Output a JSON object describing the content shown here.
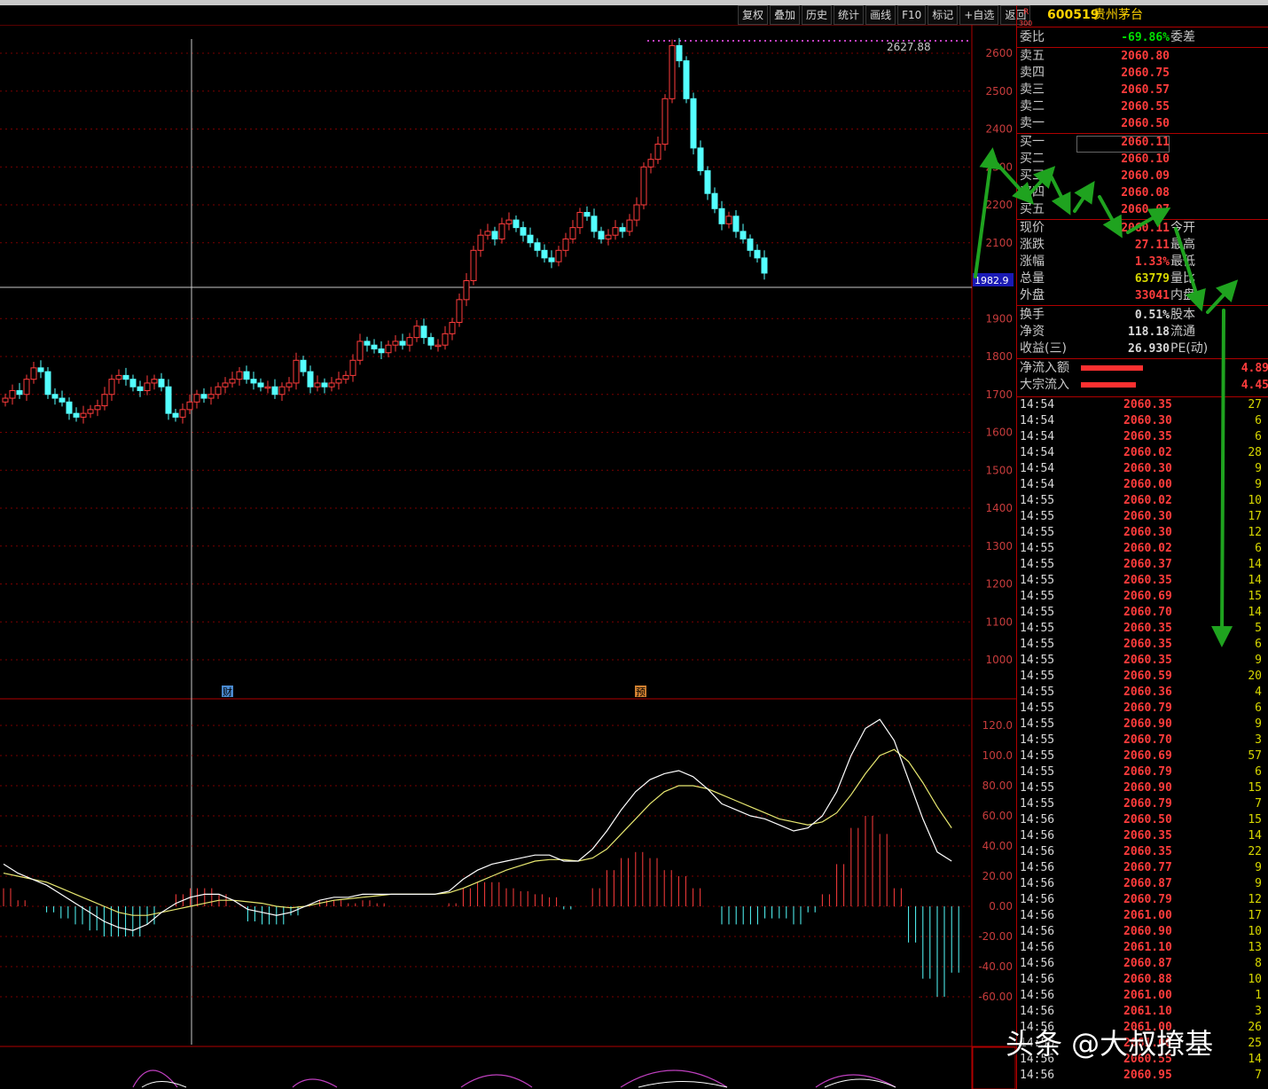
{
  "toolbar": {
    "buttons": [
      "复权",
      "叠加",
      "历史",
      "统计",
      "画线",
      "F10",
      "标记",
      "+自选",
      "返回"
    ]
  },
  "stock": {
    "r_label": "R",
    "index_label": "300",
    "code": "600519",
    "name": "贵州茅台"
  },
  "weibi": {
    "label": "委比",
    "value": "-69.86%",
    "label2": "委差"
  },
  "sell_levels": [
    {
      "label": "卖五",
      "price": "2060.80"
    },
    {
      "label": "卖四",
      "price": "2060.75"
    },
    {
      "label": "卖三",
      "price": "2060.57"
    },
    {
      "label": "卖二",
      "price": "2060.55"
    },
    {
      "label": "卖一",
      "price": "2060.50"
    }
  ],
  "buy_levels": [
    {
      "label": "买一",
      "price": "2060.11"
    },
    {
      "label": "买二",
      "price": "2060.10"
    },
    {
      "label": "买三",
      "price": "2060.09"
    },
    {
      "label": "买四",
      "price": "2060.08"
    },
    {
      "label": "买五",
      "price": "2060.07"
    }
  ],
  "quote_rows": [
    {
      "label": "现价",
      "value": "2060.11",
      "label2": "今开"
    },
    {
      "label": "涨跌",
      "value": "27.11",
      "label2": "最高"
    },
    {
      "label": "涨幅",
      "value": "1.33%",
      "label2": "最低"
    },
    {
      "label": "总量",
      "value": "63779",
      "label2": "量比"
    },
    {
      "label": "外盘",
      "value": "33041",
      "label2": "内盘"
    },
    {
      "label": "换手",
      "value": "0.51%",
      "label2": "股本"
    },
    {
      "label": "净资",
      "value": "118.18",
      "label2": "流通"
    },
    {
      "label": "收益(三)",
      "value": "26.930",
      "label2": "PE(动)"
    }
  ],
  "flows": [
    {
      "label": "净流入额",
      "value": "4.89"
    },
    {
      "label": "大宗流入",
      "value": "4.45"
    }
  ],
  "trades": [
    {
      "time": "14:54",
      "price": "2060.35",
      "vol": "27"
    },
    {
      "time": "14:54",
      "price": "2060.30",
      "vol": "6"
    },
    {
      "time": "14:54",
      "price": "2060.35",
      "vol": "6"
    },
    {
      "time": "14:54",
      "price": "2060.02",
      "vol": "28"
    },
    {
      "time": "14:54",
      "price": "2060.30",
      "vol": "9"
    },
    {
      "time": "14:54",
      "price": "2060.00",
      "vol": "9"
    },
    {
      "time": "14:55",
      "price": "2060.02",
      "vol": "10"
    },
    {
      "time": "14:55",
      "price": "2060.30",
      "vol": "17"
    },
    {
      "time": "14:55",
      "price": "2060.30",
      "vol": "12"
    },
    {
      "time": "14:55",
      "price": "2060.02",
      "vol": "6"
    },
    {
      "time": "14:55",
      "price": "2060.37",
      "vol": "14"
    },
    {
      "time": "14:55",
      "price": "2060.35",
      "vol": "14"
    },
    {
      "time": "14:55",
      "price": "2060.69",
      "vol": "15"
    },
    {
      "time": "14:55",
      "price": "2060.70",
      "vol": "14"
    },
    {
      "time": "14:55",
      "price": "2060.35",
      "vol": "5"
    },
    {
      "time": "14:55",
      "price": "2060.35",
      "vol": "6"
    },
    {
      "time": "14:55",
      "price": "2060.35",
      "vol": "9"
    },
    {
      "time": "14:55",
      "price": "2060.59",
      "vol": "20"
    },
    {
      "time": "14:55",
      "price": "2060.36",
      "vol": "4"
    },
    {
      "time": "14:55",
      "price": "2060.79",
      "vol": "6"
    },
    {
      "time": "14:55",
      "price": "2060.90",
      "vol": "9"
    },
    {
      "time": "14:55",
      "price": "2060.70",
      "vol": "3"
    },
    {
      "time": "14:55",
      "price": "2060.69",
      "vol": "57"
    },
    {
      "time": "14:55",
      "price": "2060.79",
      "vol": "6"
    },
    {
      "time": "14:55",
      "price": "2060.90",
      "vol": "15"
    },
    {
      "time": "14:55",
      "price": "2060.79",
      "vol": "7"
    },
    {
      "time": "14:56",
      "price": "2060.50",
      "vol": "15"
    },
    {
      "time": "14:56",
      "price": "2060.35",
      "vol": "14"
    },
    {
      "time": "14:56",
      "price": "2060.35",
      "vol": "22"
    },
    {
      "time": "14:56",
      "price": "2060.77",
      "vol": "9"
    },
    {
      "time": "14:56",
      "price": "2060.87",
      "vol": "9"
    },
    {
      "time": "14:56",
      "price": "2060.79",
      "vol": "12"
    },
    {
      "time": "14:56",
      "price": "2061.00",
      "vol": "17"
    },
    {
      "time": "14:56",
      "price": "2060.90",
      "vol": "10"
    },
    {
      "time": "14:56",
      "price": "2061.10",
      "vol": "13"
    },
    {
      "time": "14:56",
      "price": "2060.87",
      "vol": "8"
    },
    {
      "time": "14:56",
      "price": "2060.88",
      "vol": "10"
    },
    {
      "time": "14:56",
      "price": "2061.00",
      "vol": "1"
    },
    {
      "time": "14:56",
      "price": "2061.10",
      "vol": "3"
    },
    {
      "time": "14:56",
      "price": "2061.00",
      "vol": "26"
    },
    {
      "time": "14:56",
      "price": "2061.00",
      "vol": "25"
    },
    {
      "time": "14:56",
      "price": "2060.55",
      "vol": "14"
    },
    {
      "time": "14:56",
      "price": "2060.95",
      "vol": "7"
    }
  ],
  "main_chart": {
    "y_ticks": [
      2600,
      2500,
      2400,
      2300,
      2200,
      2100,
      1900,
      1800,
      1700,
      1600,
      1500,
      1400,
      1300,
      1200,
      1100,
      1000
    ],
    "high_label": "2627.88",
    "current_price_label": "1982.9",
    "event_markers": [
      "财",
      "预"
    ],
    "candles": [
      1690,
      1710,
      1700,
      1740,
      1770,
      1760,
      1700,
      1690,
      1680,
      1650,
      1640,
      1650,
      1660,
      1670,
      1700,
      1740,
      1750,
      1740,
      1720,
      1710,
      1730,
      1740,
      1720,
      1650,
      1640,
      1660,
      1680,
      1700,
      1690,
      1700,
      1720,
      1730,
      1740,
      1760,
      1740,
      1730,
      1720,
      1720,
      1700,
      1720,
      1730,
      1790,
      1760,
      1720,
      1730,
      1720,
      1730,
      1740,
      1750,
      1790,
      1840,
      1830,
      1820,
      1810,
      1830,
      1840,
      1830,
      1850,
      1880,
      1850,
      1830,
      1830,
      1860,
      1890,
      1950,
      2000,
      2080,
      2120,
      2130,
      2110,
      2150,
      2160,
      2140,
      2120,
      2100,
      2080,
      2060,
      2050,
      2080,
      2110,
      2140,
      2180,
      2170,
      2130,
      2110,
      2120,
      2140,
      2130,
      2160,
      2200,
      2300,
      2320,
      2360,
      2480,
      2620,
      2580,
      2480,
      2350,
      2290,
      2230,
      2190,
      2150,
      2170,
      2130,
      2110,
      2080,
      2060,
      2020
    ]
  },
  "macd_chart": {
    "y_ticks": [
      "120.0",
      "100.0",
      "80.00",
      "60.00",
      "40.00",
      "20.00",
      "0.00",
      "-20.00",
      "-40.00",
      "-60.00"
    ],
    "dif": [
      28,
      22,
      18,
      14,
      8,
      2,
      -4,
      -10,
      -14,
      -16,
      -12,
      -4,
      2,
      6,
      8,
      8,
      4,
      -2,
      -4,
      -6,
      -4,
      0,
      4,
      6,
      6,
      8,
      8,
      8,
      8,
      8,
      8,
      10,
      18,
      24,
      28,
      30,
      32,
      34,
      34,
      30,
      30,
      38,
      50,
      64,
      76,
      84,
      88,
      90,
      86,
      78,
      68,
      64,
      60,
      58,
      54,
      50,
      52,
      60,
      76,
      100,
      118,
      124,
      110,
      84,
      58,
      36,
      30
    ],
    "dea": [
      22,
      20,
      18,
      16,
      12,
      8,
      4,
      0,
      -4,
      -6,
      -6,
      -4,
      -2,
      0,
      2,
      4,
      4,
      3,
      2,
      0,
      -1,
      0,
      2,
      4,
      5,
      6,
      7,
      8,
      8,
      8,
      8,
      9,
      12,
      16,
      20,
      24,
      27,
      30,
      31,
      31,
      30,
      32,
      38,
      48,
      58,
      68,
      76,
      80,
      80,
      78,
      74,
      70,
      66,
      62,
      58,
      56,
      54,
      56,
      62,
      74,
      88,
      100,
      104,
      96,
      82,
      66,
      52
    ]
  },
  "watermark": "头条 @大叔撩基"
}
